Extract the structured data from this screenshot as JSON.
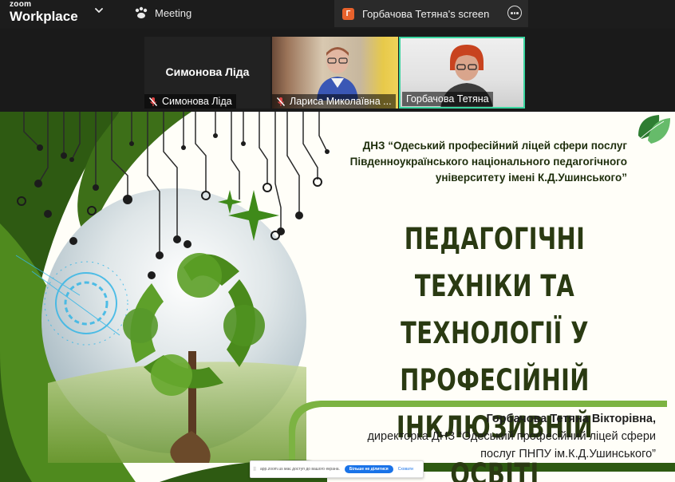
{
  "app": {
    "brand_top": "zoom",
    "brand_bottom": "Workplace"
  },
  "tabs": {
    "meeting_label": "Meeting",
    "screen_badge": "Г",
    "screen_title": "Горбачова Тетяна's screen"
  },
  "participants": [
    {
      "name": "Симонова Ліда",
      "display_name": "Симонова Ліда",
      "muted": true,
      "video": false
    },
    {
      "name": "Лариса Миколаївна ...",
      "muted": true,
      "video": true
    },
    {
      "name": "Горбачова Тетяна",
      "muted": false,
      "video": true,
      "active_speaker": true
    }
  ],
  "slide": {
    "org_lines": [
      "ДНЗ “Одеський професійний ліцей сфери послуг",
      "Південноукраїнського національного педагогічного",
      "університету імені К.Д.Ушинського”"
    ],
    "title_lines": [
      "ПЕДАГОГІЧНІ ТЕХНІКИ ТА",
      "ТЕХНОЛОГІЇ У ПРОФЕСІЙНІЙ",
      "ІНКЛЮЗИВНІЙ ОСВІТІ"
    ],
    "author_name": "Горбачова Тетяна Вікторівна,",
    "author_lines": [
      "директорка ДНЗ “Одеський професійний ліцей сфери",
      "послуг ПНПУ ім.К.Д.Ушинського”"
    ]
  },
  "share_notice": {
    "handle": "⠿",
    "message": "app.zoom.us має доступ до вашого екрана.",
    "stop_label": "Більше не ділитися",
    "hide_label": "Сховати"
  },
  "colors": {
    "topbar_bg": "#1c1c1c",
    "active_border": "#3ad6a0",
    "screen_badge": "#e8622c",
    "slide_dark_green": "#2e5a12",
    "slide_mid_green": "#4f8a1e",
    "slide_light_green": "#8bc34a",
    "title_text": "#2a3a12"
  },
  "icons": {
    "brand_menu": "chevron-down-icon",
    "meeting": "paw-participants-icon",
    "more": "more-options-icon",
    "mic": "mic-muted-icon",
    "leaves": "leaves-logo-icon"
  }
}
